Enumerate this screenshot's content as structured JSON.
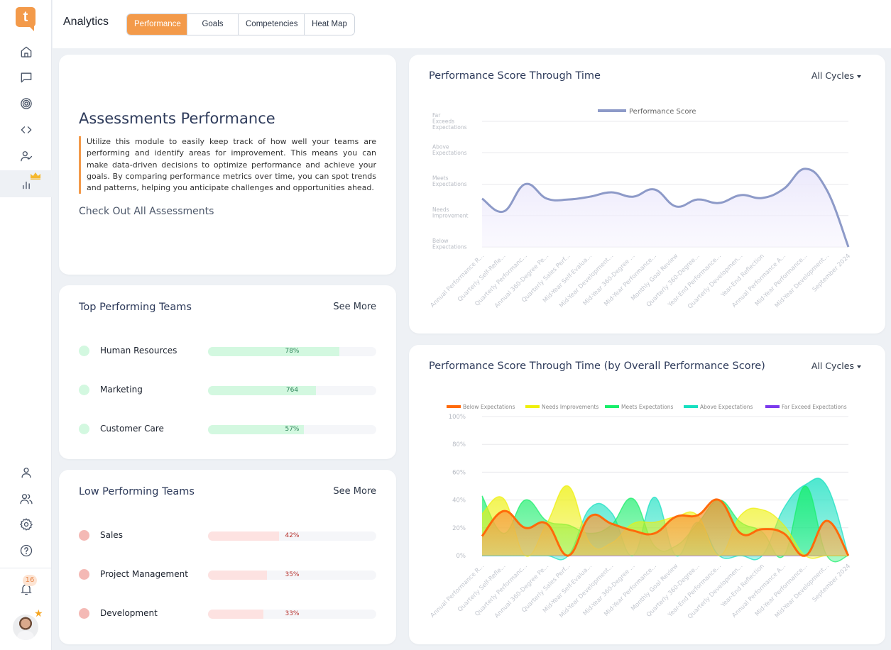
{
  "app": {
    "logo_letter": "t",
    "page_title": "Analytics"
  },
  "sidebar": {
    "items": [
      {
        "name": "home-icon"
      },
      {
        "name": "chat-icon"
      },
      {
        "name": "target-icon"
      },
      {
        "name": "code-icon"
      },
      {
        "name": "user-check-icon"
      },
      {
        "name": "analytics-icon",
        "active": true,
        "premium": true
      }
    ],
    "bottom_items": [
      {
        "name": "user-icon"
      },
      {
        "name": "users-icon"
      },
      {
        "name": "gear-icon"
      },
      {
        "name": "help-icon"
      }
    ],
    "notifications_count": "16"
  },
  "tabs": [
    {
      "label": "Performance",
      "active": true
    },
    {
      "label": "Goals"
    },
    {
      "label": "Competencies"
    },
    {
      "label": "Heat Map"
    }
  ],
  "intro": {
    "title": "Assessments Performance",
    "description": "Utilize this module to easily keep track of how well your teams are performing and identify areas for improvement. This means you can make data-driven decisions to optimize performance and achieve your goals. By comparing performance metrics over time, you can spot trends and patterns, helping you anticipate challenges and opportunities ahead.",
    "link": "Check Out All Assessments"
  },
  "top_teams": {
    "title": "Top Performing Teams",
    "see_more": "See More",
    "rows": [
      {
        "name": "Human Resources",
        "label": "78%",
        "fill": 0.78
      },
      {
        "name": "Marketing",
        "label": "764",
        "fill": 0.64
      },
      {
        "name": "Customer Care",
        "label": "57%",
        "fill": 0.57
      }
    ]
  },
  "low_teams": {
    "title": "Low Performing Teams",
    "see_more": "See More",
    "rows": [
      {
        "name": "Sales",
        "label": "42%",
        "fill": 0.42
      },
      {
        "name": "Project Management",
        "label": "35%",
        "fill": 0.35
      },
      {
        "name": "Development",
        "label": "33%",
        "fill": 0.33
      }
    ]
  },
  "chart1_card": {
    "title": "Performance Score Through Time",
    "filter": "All Cycles"
  },
  "chart2_card": {
    "title": "Performance Score Through Time (by Overall Performance Score)",
    "filter": "All Cycles"
  },
  "chart_data": [
    {
      "type": "area",
      "title": "Performance Score Through Time",
      "legend": [
        "Performance Score"
      ],
      "legend_position": "top-center",
      "ylabel": "",
      "xlabel": "",
      "y_tick_labels": [
        "Below Expectations",
        "Needs Improvement",
        "Meets Expectations",
        "Above Expectations",
        "Far Exceeds Expectations"
      ],
      "ylim": [
        0,
        4
      ],
      "grid": true,
      "x": [
        "Annual Performance R...",
        "Quarterly Self-Refle...",
        "Quarterly Performanc...",
        "Annual 360-Degree Pe...",
        "Quarterly Sales Perf...",
        "Mid-Year Self-Evalua...",
        "Mid-Year Development...",
        "Mid-Year 360-Degree ...",
        "Mid-Year Performance...",
        "Monthly Goal Review",
        "Quarterly 360-Degree...",
        "Year-End Performance...",
        "Quarterly Developmen...",
        "Year-End Reflection",
        "Annual Performance A...",
        "Mid-Year Performance...",
        "Mid-Year Development...",
        "September 2024"
      ],
      "series": [
        {
          "name": "Performance Score",
          "color": "#8d9ac8",
          "values": [
            1.54,
            1.13,
            2.0,
            1.54,
            1.51,
            1.6,
            1.74,
            1.6,
            1.83,
            1.29,
            1.51,
            1.4,
            1.65,
            1.56,
            1.85,
            2.49,
            1.81,
            0
          ]
        }
      ]
    },
    {
      "type": "area",
      "title": "Performance Score Through Time (by Overall Performance Score)",
      "legend_position": "top-center",
      "ylabel": "",
      "xlabel": "",
      "ylim": [
        0,
        100
      ],
      "y_ticks": [
        "0%",
        "20%",
        "40%",
        "60%",
        "80%",
        "100%"
      ],
      "grid": true,
      "x": [
        "Annual Performance R...",
        "Quarterly Self-Refle...",
        "Quarterly Performanc...",
        "Annual 360-Degree Pe...",
        "Quarterly Sales Perf...",
        "Mid-Year Self-Evalua...",
        "Mid-Year Development...",
        "Mid-Year 360-Degree ...",
        "Mid-Year Performance...",
        "Monthly Goal Review",
        "Quarterly 360-Degree...",
        "Year-End Performance...",
        "Quarterly Developmen...",
        "Year-End Reflection",
        "Annual Performance A...",
        "Mid-Year Performance...",
        "Mid-Year Development...",
        "September 2024"
      ],
      "series": [
        {
          "name": "Far Exceed Expectations",
          "color": "#7c3aed",
          "values": [
            0,
            0,
            0,
            0,
            0,
            0,
            0,
            0,
            0,
            0,
            0,
            0,
            0,
            0,
            0,
            0,
            0,
            0
          ]
        },
        {
          "name": "Above Expectations",
          "color": "#16e0c0",
          "values": [
            0,
            0,
            0,
            0,
            0,
            34,
            31,
            0,
            42,
            0,
            24,
            0,
            0,
            0,
            34,
            51,
            50,
            0
          ]
        },
        {
          "name": "Meets Expectations",
          "color": "#18ee6a",
          "values": [
            43,
            16,
            40,
            25,
            22,
            16,
            22,
            41,
            7,
            7,
            23,
            40,
            24,
            17,
            0,
            50,
            0,
            0
          ]
        },
        {
          "name": "Needs Improvements",
          "color": "#eef00a",
          "values": [
            30,
            41,
            0,
            23,
            50,
            9,
            9,
            23,
            24,
            28,
            29,
            0,
            29,
            33,
            22,
            0,
            0,
            0
          ]
        },
        {
          "name": "Below Expectations",
          "color": "#ff6a0a",
          "values": [
            14,
            32,
            20,
            23,
            0,
            28,
            23,
            18,
            16,
            28,
            29,
            40,
            16,
            19,
            16,
            0,
            25,
            0
          ]
        }
      ],
      "legend": [
        "Below Expectations",
        "Needs Improvements",
        "Meets Expectations",
        "Above Expectations",
        "Far Exceed Expectations"
      ]
    }
  ]
}
